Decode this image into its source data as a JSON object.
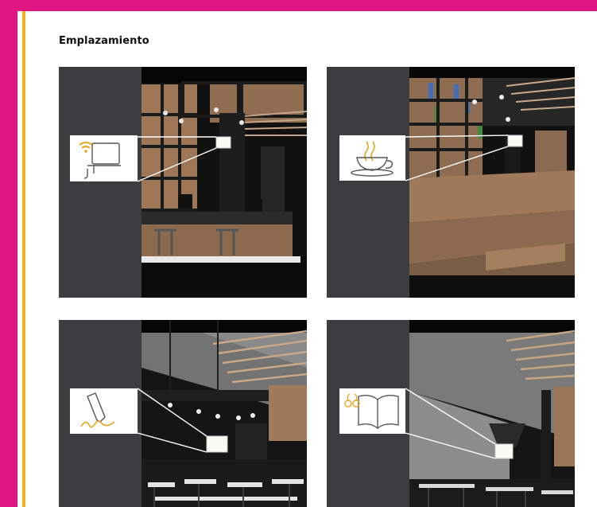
{
  "section": {
    "title": "Emplazamiento"
  },
  "panels": [
    {
      "id": "wifi-workspace",
      "icon": "wifi-desk-icon"
    },
    {
      "id": "cafe-terraces",
      "icon": "coffee-cup-icon"
    },
    {
      "id": "study-area",
      "icon": "pen-signature-icon"
    },
    {
      "id": "reading-area",
      "icon": "open-book-glasses-icon"
    }
  ],
  "colors": {
    "brand_magenta": "#e0157f",
    "accent_gold": "#f0b31d",
    "panel_dark": "#3b3d3e",
    "cork": "#9c7656"
  }
}
